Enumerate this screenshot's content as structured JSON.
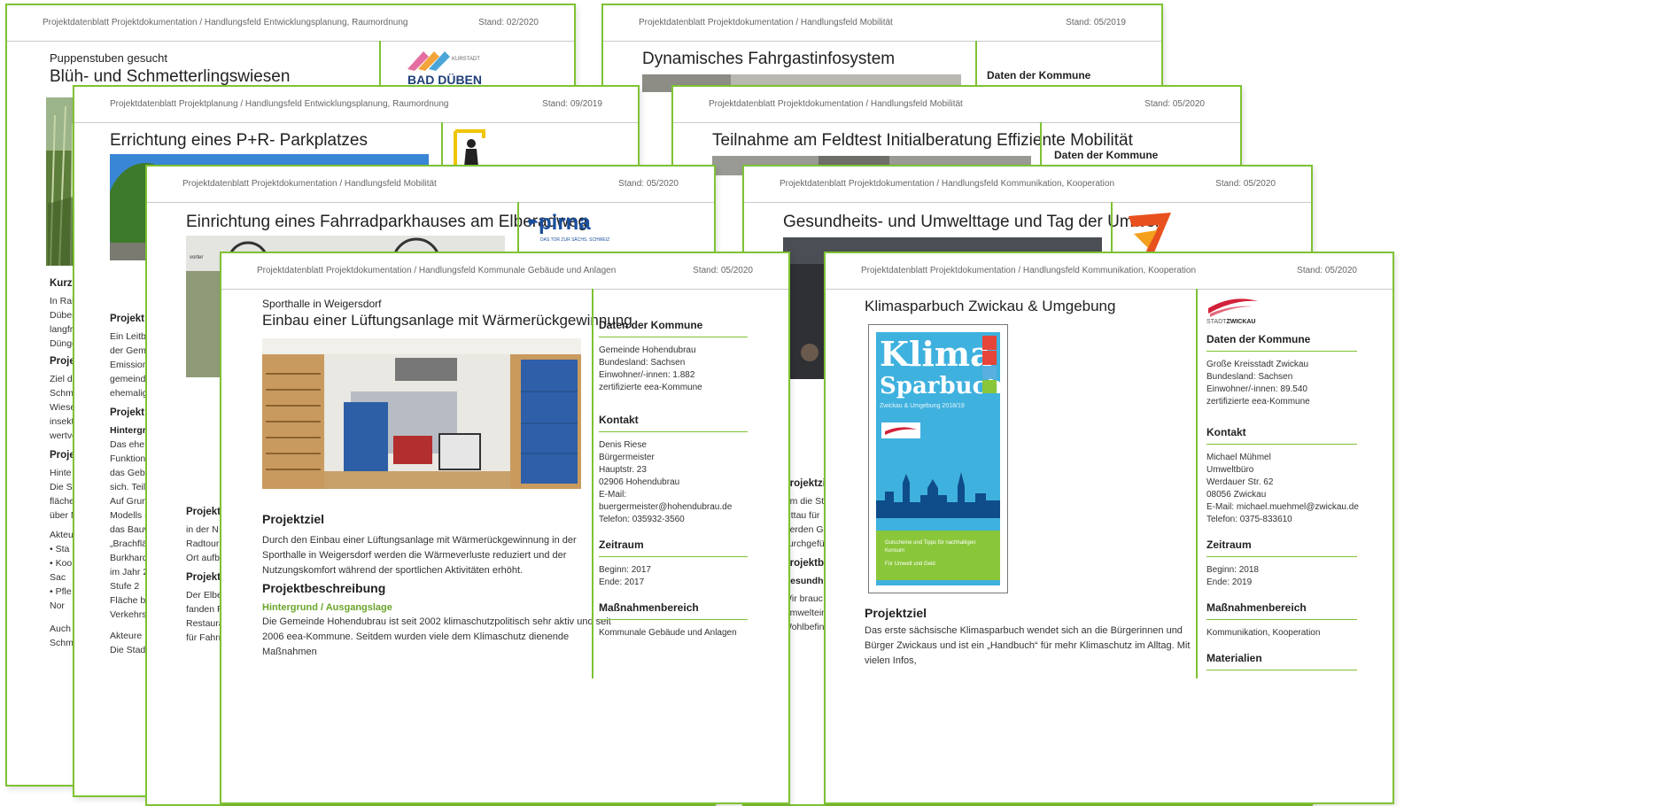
{
  "colors": {
    "accent": "#7ec234",
    "pirna_blue": "#1a4f9c",
    "zwickau_red": "#d3213a"
  },
  "sheet1": {
    "crumb": "Projektdatenblatt Projektdokumentation / Handlungsfeld Entwicklungsplanung, Raumordnung",
    "stand": "Stand: 02/2020",
    "subtitle": "Puppenstuben gesucht",
    "title": "Blüh- und Schmetterlingswiesen",
    "logo_small": "KURSTADT",
    "logo_text": "BAD DÜBEN",
    "frag": [
      "Kurzb",
      "In Rah",
      "Düben",
      "langfri",
      "Dünge",
      "Proje",
      "Ziel d",
      "Schme",
      "Wiese",
      "insekt",
      "wertvo",
      "Proje",
      "Hinte",
      "Die St",
      "fläche",
      "über N",
      "Akteu",
      "• Sta",
      "• Koo",
      "Sac",
      "• Pfle",
      "Nor",
      "Auch",
      "Schme"
    ]
  },
  "sheet2": {
    "crumb": "Projektdatenblatt Projektdokumentation / Handlungsfeld Mobilität",
    "stand": "Stand: 05/2019",
    "title": "Dynamisches Fahrgastinfosystem",
    "side_heading": "Daten der Kommune"
  },
  "sheet3": {
    "crumb": "Projektdatenblatt Projektplanung / Handlungsfeld Entwicklungsplanung, Raumordnung",
    "stand": "Stand: 09/2019",
    "title": "Errichtung eines P+R- Parkplatzes",
    "frag": [
      "Projekt",
      "Ein Leitb",
      "der Gem",
      "Emission",
      "gemeinde",
      "ehemalig",
      "Projekt",
      "Hintergr",
      "Das ehe",
      "Funktion",
      "das Geb",
      "sich. Teil",
      "Auf Grun",
      "Modells S",
      "das Bauv",
      "„Brachflä",
      "Burkhard",
      "im Jahr 2",
      "Stufe 2 ",
      "Fläche bl",
      "Verkehrs",
      "Akteure",
      "Die Stad"
    ]
  },
  "sheet4": {
    "crumb": "Projektdatenblatt Projektdokumentation / Handlungsfeld Mobilität",
    "stand": "Stand: 05/2020",
    "title": "Teilnahme am Feldtest Initialberatung Effiziente Mobilität",
    "side_heading": "Daten der Kommune"
  },
  "sheet5": {
    "crumb": "Projektdatenblatt Projektdokumentation / Handlungsfeld Mobilität",
    "stand": "Stand: 05/2020",
    "title": "Einrichtung eines Fahrradparkhauses am Elberadweg",
    "logo_text": "pirna",
    "logo_sub": "DAS TOR ZUR SÄCHS. SCHWEIZ",
    "photo_caption": "vorter",
    "frag": [
      "Projekt",
      "in der N",
      "Radtouri",
      "Ort aufb",
      "Projekt",
      "Der Elbe",
      "fanden F",
      "Restaura",
      "für Fahrr"
    ]
  },
  "sheet6": {
    "crumb": "Projektdatenblatt Projektdokumentation / Handlungsfeld Kommunikation, Kooperation",
    "stand": "Stand: 05/2020",
    "title": "Gesundheits- und Umwelttage und Tag der Umwelt",
    "frag": [
      "Projektzi",
      "Um die Stu",
      "Zittau für",
      "werden G",
      "durchgefü",
      "Projektb",
      "Gesundhe",
      "Wir brauc",
      "Umweltein",
      "Wohlbefin"
    ]
  },
  "sheet7": {
    "crumb": "Projektdatenblatt Projektdokumentation / Handlungsfeld Kommunale Gebäude und Anlagen",
    "stand": "Stand: 05/2020",
    "subtitle": "Sporthalle in Weigersdorf",
    "title": "Einbau einer Lüftungsanlage mit Wärmerückgewinnung",
    "projektziel_h": "Projektziel",
    "projektziel_text": "Durch den Einbau einer Lüftungsanlage mit Wärmerückgewinnung in der Sporthalle in Weigersdorf werden die Wärmeverluste reduziert und der Nutzungskomfort während der sportlichen Aktivitäten erhöht.",
    "beschreibung_h": "Projektbeschreibung",
    "hintergrund_h": "Hintergrund / Ausgangslage",
    "hintergrund_text": "Die Gemeinde Hohendubrau ist seit 2002 klimaschutzpolitisch sehr aktiv und seit 2006 eea-Kommune. Seitdem wurden viele dem Klimaschutz dienende Maßnahmen",
    "side": {
      "daten_h": "Daten der Kommune",
      "daten": [
        "Gemeinde Hohendubrau",
        "Bundesland: Sachsen",
        "Einwohner/-innen: 1.882",
        "zertifizierte eea-Kommune"
      ],
      "kontakt_h": "Kontakt",
      "kontakt": [
        "Denis Riese",
        "Bürgermeister",
        "Hauptstr. 23",
        "02906 Hohendubrau",
        "E-Mail:",
        "buergermeister@hohendubrau.de",
        "Telefon: 035932-3560"
      ],
      "zeitraum_h": "Zeitraum",
      "zeitraum": [
        "Beginn: 2017",
        "Ende: 2017"
      ],
      "massnahmen_h": "Maßnahmenbereich",
      "massnahmen": [
        "Kommunale Gebäude und Anlagen"
      ]
    }
  },
  "sheet8": {
    "crumb": "Projektdatenblatt Projektdokumentation / Handlungsfeld Kommunikation, Kooperation",
    "stand": "Stand: 05/2020",
    "title": "Klimasparbuch Zwickau & Umgebung",
    "cover": {
      "klima": "Klima",
      "sparbuch": "Sparbuch",
      "region": "Zwickau & Umgebung 2018/19",
      "blurb1": "Gutscheine und Tipps für nachhaltigen Konsum",
      "blurb2": "Für Umwelt und Geld"
    },
    "logo_prefix": "STADT",
    "logo_name": "ZWICKAU",
    "projektziel_h": "Projektziel",
    "projektziel_text": "Das erste sächsische Klimasparbuch wendet sich an die Bürgerinnen und Bürger Zwickaus und ist ein „Handbuch“ für mehr Klimaschutz im Alltag. Mit vielen Infos,",
    "side": {
      "daten_h": "Daten der Kommune",
      "daten": [
        "Große Kreisstadt Zwickau",
        "Bundesland: Sachsen",
        "Einwohner/-innen: 89.540",
        "zertifizierte eea-Kommune"
      ],
      "kontakt_h": "Kontakt",
      "kontakt": [
        "Michael Mühmel",
        "Umweltbüro",
        "Werdauer Str. 62",
        "08056 Zwickau",
        "E-Mail: michael.muehmel@zwickau.de",
        "Telefon: 0375-833610"
      ],
      "zeitraum_h": "Zeitraum",
      "zeitraum": [
        "Beginn: 2018",
        "Ende: 2019"
      ],
      "massnahmen_h": "Maßnahmenbereich",
      "massnahmen": [
        "Kommunikation, Kooperation"
      ],
      "materialien_h": "Materialien"
    }
  }
}
